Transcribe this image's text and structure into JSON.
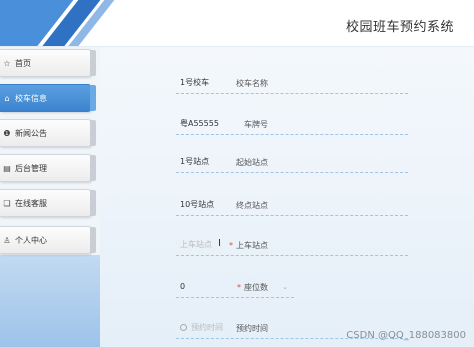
{
  "header": {
    "title": "校园班车预约系统"
  },
  "sidebar": {
    "items": [
      {
        "label": "首页",
        "icon": "star-icon",
        "active": false
      },
      {
        "label": "校车信息",
        "icon": "home-icon",
        "active": true
      },
      {
        "label": "新闻公告",
        "icon": "info-icon",
        "active": false
      },
      {
        "label": "后台管理",
        "icon": "archive-icon",
        "active": false
      },
      {
        "label": "在线客服",
        "icon": "chat-icon",
        "active": false
      },
      {
        "label": "个人中心",
        "icon": "user-icon",
        "active": false
      }
    ]
  },
  "form": {
    "bus_name": {
      "label": "校车名称",
      "value": "1号校车"
    },
    "plate": {
      "label": "车牌号",
      "value": "粤A55555"
    },
    "start": {
      "label": "起始站点",
      "value": "1号站点"
    },
    "end": {
      "label": "终点站点",
      "value": "10号站点"
    },
    "boarding": {
      "required": "*",
      "label": "上车站点",
      "placeholder": "上车站点"
    },
    "seats": {
      "required": "*",
      "label": "座位数",
      "value": "0"
    },
    "time": {
      "label": "预约时间",
      "placeholder": "预约时间"
    }
  },
  "watermark": "CSDN @QQ_188083800",
  "colors": {
    "accent": "#3c84cf",
    "required": "#e04a4a"
  }
}
